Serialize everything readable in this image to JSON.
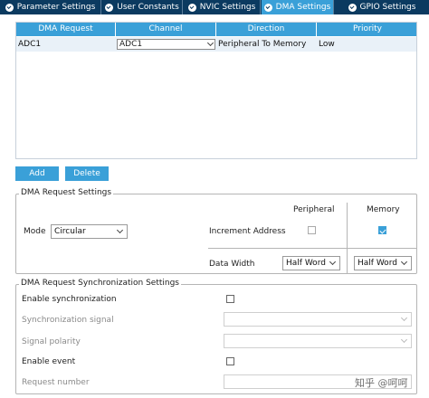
{
  "tabs": [
    {
      "label": "Parameter Settings"
    },
    {
      "label": "User Constants"
    },
    {
      "label": "NVIC Settings"
    },
    {
      "label": "DMA Settings"
    },
    {
      "label": "GPIO Settings"
    }
  ],
  "table": {
    "headers": [
      "DMA Request",
      "Channel",
      "Direction",
      "Priority"
    ],
    "row": {
      "request": "ADC1",
      "channel": "ADC1",
      "direction": "Peripheral To Memory",
      "priority": "Low"
    }
  },
  "buttons": {
    "add": "Add",
    "delete": "Delete"
  },
  "dma_settings": {
    "legend": "DMA Request Settings",
    "peripheral_col": "Peripheral",
    "memory_col": "Memory",
    "mode_label": "Mode",
    "mode_value": "Circular",
    "increment_label": "Increment Address",
    "increment_peripheral": false,
    "increment_memory": true,
    "data_width_label": "Data Width",
    "peripheral_width": "Half Word",
    "memory_width": "Half Word"
  },
  "sync_settings": {
    "legend": "DMA Request Synchronization Settings",
    "enable_sync_label": "Enable synchronization",
    "sync_signal_label": "Synchronization signal",
    "signal_polarity_label": "Signal polarity",
    "enable_event_label": "Enable event",
    "request_number_label": "Request number"
  },
  "watermark": "知乎 @呵呵",
  "colors": {
    "tab_bar": "#0b3a60",
    "accent": "#3aa0d8",
    "row_highlight": "#e9f1f8"
  },
  "icons": {
    "tab_status": "check-circle-icon",
    "dropdown": "chevron-down-icon"
  }
}
